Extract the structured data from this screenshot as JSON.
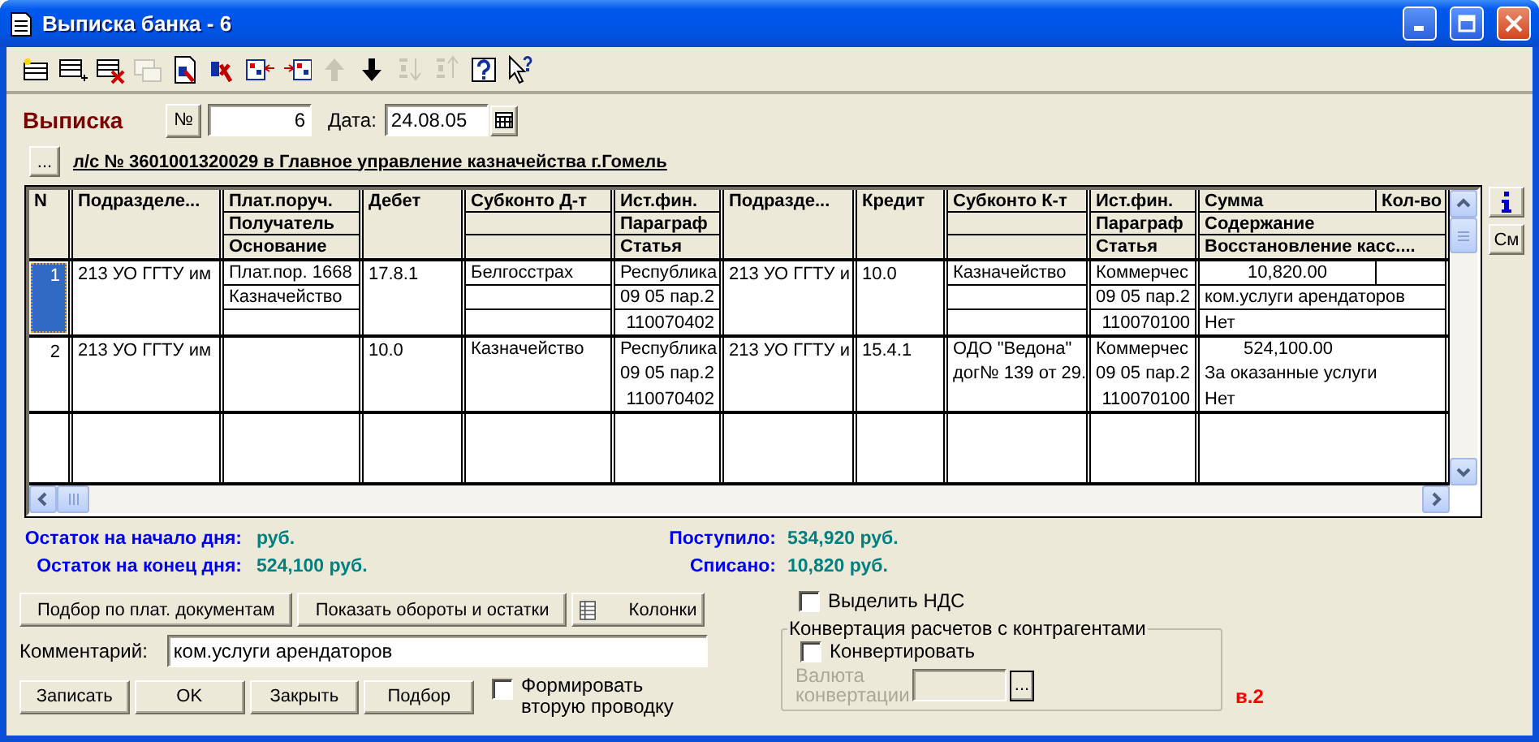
{
  "window": {
    "title": "Выписка банка - 6"
  },
  "toolbar": [
    {
      "disabled": false
    },
    {
      "disabled": false
    },
    {
      "disabled": false
    },
    {
      "disabled": true
    },
    {
      "disabled": false
    },
    {
      "disabled": false
    },
    {
      "disabled": false
    },
    {
      "disabled": false
    },
    {
      "disabled": true
    },
    {
      "disabled": false
    },
    {
      "disabled": true
    },
    {
      "disabled": true
    },
    {
      "disabled": false
    },
    {
      "disabled": false
    }
  ],
  "header": {
    "title": "Выписка",
    "number_button": "№",
    "number": "6",
    "date_label": "Дата:",
    "date": "24.08.05"
  },
  "account": {
    "button": "...",
    "text": "л/с № 3601001320029 в Главное управление казначейства г.Гомель"
  },
  "table": {
    "columns": [
      {
        "kind": "single",
        "header": [
          "N"
        ]
      },
      {
        "kind": "single",
        "header": [
          "Подразделе..."
        ]
      },
      {
        "kind": "triple",
        "header": [
          "Плат.поруч.",
          "Получатель",
          "Основание"
        ]
      },
      {
        "kind": "single",
        "header": [
          "Дебет"
        ]
      },
      {
        "kind": "triple",
        "header": [
          "Субконто Д-т"
        ]
      },
      {
        "kind": "triple",
        "header": [
          "Ист.фин.",
          "Параграф",
          "Статья"
        ]
      },
      {
        "kind": "single",
        "header": [
          "Подразде..."
        ]
      },
      {
        "kind": "single",
        "header": [
          "Кредит"
        ]
      },
      {
        "kind": "triple",
        "header": [
          "Субконто К-т"
        ]
      },
      {
        "kind": "triple",
        "header": [
          "Ист.фин.",
          "Параграф",
          "Статья"
        ]
      },
      {
        "kind": "split",
        "header": [
          "Сумма",
          "Кол-во",
          "Содержание",
          "Восстановление касс...."
        ]
      }
    ],
    "rows": [
      {
        "selected": true,
        "cells": [
          [
            "1"
          ],
          [
            "213 УО ГГТУ им"
          ],
          [
            "Плат.пор. 1668",
            "Казначейство"
          ],
          [
            "17.8.1"
          ],
          [
            "Белгосстрах"
          ],
          [
            "Республика",
            "09 05 пар.2",
            "110070402"
          ],
          [
            "213 УО ГГТУ и"
          ],
          [
            "10.0"
          ],
          [
            "Казначейство"
          ],
          [
            "Коммерчес",
            "09 05 пар.2",
            "110070100"
          ],
          [
            "10,820.00",
            "ком.услуги арендаторов",
            "Нет"
          ]
        ]
      },
      {
        "selected": false,
        "cells": [
          [
            "2"
          ],
          [
            "213 УО ГГТУ им"
          ],
          null,
          [
            "10.0"
          ],
          [
            "Казначейство"
          ],
          [
            "Республика",
            "09 05 пар.2",
            "110070402"
          ],
          [
            "213 УО ГГТУ и"
          ],
          [
            "15.4.1"
          ],
          [
            "ОДО \"Ведона\"",
            "дог№ 139 от 29."
          ],
          [
            "Коммерчес",
            "09 05 пар.2",
            "110070100"
          ],
          [
            "524,100.00",
            "За оказанные услуги",
            "Нет"
          ]
        ]
      }
    ]
  },
  "side_button": "См",
  "totals": [
    {
      "label": "Остаток на начало дня:",
      "value": "руб."
    },
    {
      "label": "Поступило:",
      "value": "534,920 руб."
    },
    {
      "label": "Остаток на конец дня:",
      "value": "524,100 руб."
    },
    {
      "label": "Списано:",
      "value": "10,820 руб."
    }
  ],
  "actions": [
    {
      "kind": "text",
      "label": "Подбор по плат. документам"
    },
    {
      "kind": "text",
      "label": "Показать обороты и остатки"
    },
    {
      "kind": "icon",
      "label": "Колонки"
    }
  ],
  "comment": {
    "label": "Комментарий:",
    "value": "ком.услуги арендаторов"
  },
  "buttons": [
    "Записать",
    "OK",
    "Закрыть",
    "Подбор"
  ],
  "second_entry": {
    "label": "Формировать вторую проводку",
    "checked": false
  },
  "vat": {
    "label": "Выделить НДС",
    "checked": false
  },
  "conversion": {
    "title": "Конвертация расчетов с контрагентами",
    "convert": {
      "label": "Конвертировать",
      "checked": false
    },
    "currency_label": "Валюта конвертации",
    "disabled": true,
    "picker_button": "..."
  },
  "version": "в.2"
}
